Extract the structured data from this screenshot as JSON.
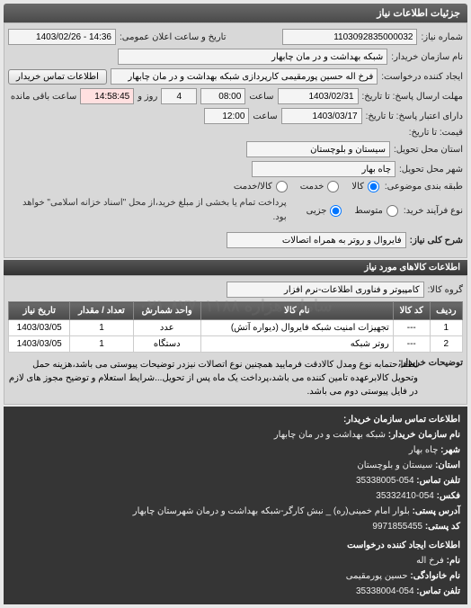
{
  "header": {
    "title": "جزئیات اطلاعات نیاز"
  },
  "fields": {
    "need_no_label": "شماره نیاز:",
    "need_no": "1103092835000032",
    "announce_label": "تاریخ و ساعت اعلان عمومی:",
    "announce": "14:36 - 1403/02/26",
    "buyer_name_label": "نام سازمان خریدار:",
    "buyer_name": "شبکه بهداشت و در مان چابهار",
    "requester_label": "ایجاد کننده درخواست:",
    "requester": "فرخ اله حسین پورمقیمی کارپردازی شبکه بهداشت و در مان چابهار",
    "contact_btn": "اطلاعات تماس خریدار",
    "deadline_send_label": "مهلت ارسال پاسخ: تا تاریخ:",
    "deadline_send_date": "1403/02/31",
    "deadline_send_time_label": "ساعت",
    "deadline_send_time": "08:00",
    "remain_num": "4",
    "remain_day_label": "روز و",
    "remain_time": "14:58:45",
    "remain_left_label": "ساعت باقی مانده",
    "valid_until_label": "دارای اعتبار پاسخ: تا تاریخ:",
    "valid_until_date": "1403/03/17",
    "valid_until_time": "12:00",
    "price_label": "قیمت: تا تاریخ:",
    "province_label": "استان محل تحویل:",
    "province": "سیستان و بلوچستان",
    "city_label": "شهر محل تحویل:",
    "city": "چاه بهار",
    "pack_label": "طبقه بندی موضوعی:",
    "pack_opt1": "کالا",
    "pack_opt2": "خدمت",
    "pack_opt3": "کالا/خدمت",
    "proc_label": "نوع فرآیند خرید:",
    "proc_opt1": "متوسط",
    "proc_opt2": "جزیی",
    "proc_note": "پرداخت تمام یا بخشی از مبلغ خرید،از محل \"اسناد خزانه اسلامی\" خواهد بود.",
    "subject_label": "شرح کلی نیاز:",
    "subject": "فایروال و روتر به همراه اتصالات"
  },
  "items_header": "اطلاعات کالاهای مورد نیاز",
  "items_group_label": "گروه کالا:",
  "items_group": "کامپیوتر و فناوری اطلاعات-نرم افزار",
  "table": {
    "cols": [
      "ردیف",
      "کد کالا",
      "نام کالا",
      "واحد شمارش",
      "تعداد / مقدار",
      "تاریخ نیاز"
    ],
    "rows": [
      [
        "1",
        "---",
        "تجهیزات امنیت شبکه فایروال (دیواره آتش)",
        "عدد",
        "1",
        "1403/03/05"
      ],
      [
        "2",
        "---",
        "روتر شبکه",
        "دستگاه",
        "1",
        "1403/03/05"
      ]
    ]
  },
  "buyer_desc_label": "توضیحات خریدار:",
  "buyer_desc": "لطفا،حتمابه نوع ومدل کالادقت فرمایید همچنین نوع اتصالات نیزدر توضیحات پیوستی می باشد،هزینه حمل وتحویل کالابرعهده تامین کننده می باشد،پرداخت یک ماه پس از تحویل...شرایط استعلام و توضیح مجوز های لازم در فایل پیوستی دوم می باشد.",
  "contact_header": "اطلاعات تماس سازمان خریدار:",
  "contact": {
    "org_label": "نام سازمان خریدار:",
    "org": "شبکه بهداشت و در مان چابهار",
    "city_label": "شهر:",
    "city": "چاه بهار",
    "province_label": "استان:",
    "province": "سیستان و بلوچستان",
    "phone_label": "تلفن تماس:",
    "phone": "054-35338005",
    "fax_label": "فکس:",
    "fax": "054-35332410",
    "address_label": "آدرس پستی:",
    "address": "بلوار امام خمینی(ره) _ نبش کارگر-شبکه بهداشت و درمان شهرستان چابهار",
    "postal_label": "کد پستی:",
    "postal": "9971855455"
  },
  "creator_header": "اطلاعات ایجاد کننده درخواست",
  "creator": {
    "name_label": "نام:",
    "name": "فرخ اله",
    "family_label": "نام خانوادگی:",
    "family": "حسین پورمقیمی",
    "phone_label": "تلفن تماس:",
    "phone": "054-35338004"
  },
  "watermark": "سامانه هزاره ۸۷۷۰۱۱۸۸-۰۲۱"
}
